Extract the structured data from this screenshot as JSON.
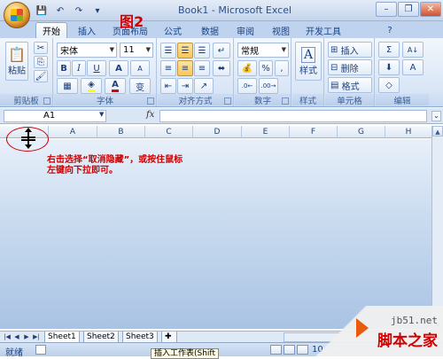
{
  "window": {
    "title": "Book1 - Microsoft Excel",
    "minimize": "–",
    "restore": "❐",
    "close": "✕"
  },
  "qat": {
    "save": "💾",
    "undo": "↶",
    "redo": "↷",
    "customize": "▾"
  },
  "annotation": {
    "figure_label": "图2",
    "instruction": "右击选择“取消隐藏”，或按住鼠标左键向下拉即可。"
  },
  "ribbon": {
    "tabs": [
      "开始",
      "插入",
      "页面布局",
      "公式",
      "数据",
      "审阅",
      "视图",
      "开发工具"
    ],
    "active_tab": "开始",
    "help": "?",
    "clipboard": {
      "label": "剪贴板",
      "paste": "粘贴"
    },
    "font": {
      "label": "字体",
      "name": "宋体",
      "size": "11",
      "grow": "A",
      "shrink": "A",
      "bold": "B",
      "italic": "I",
      "underline": "U",
      "phonetic": "变"
    },
    "alignment": {
      "label": "对齐方式"
    },
    "number": {
      "label": "数字",
      "format": "常规",
      "percent": "%",
      "comma": ","
    },
    "styles": {
      "label": "样式",
      "button": "样式"
    },
    "cells": {
      "label": "单元格",
      "insert": "插入",
      "delete": "删除",
      "format": "格式"
    },
    "editing": {
      "label": "编辑",
      "sum": "Σ",
      "sort": "A↓",
      "find": "A"
    }
  },
  "formula_bar": {
    "name_box": "A1",
    "fx": "fx",
    "value": ""
  },
  "sheet": {
    "columns": [
      "A",
      "B",
      "C",
      "D",
      "E",
      "F",
      "G",
      "H"
    ]
  },
  "sheet_tabs": [
    "Sheet1",
    "Sheet2",
    "Sheet3"
  ],
  "active_sheet": "Sheet1",
  "status": {
    "ready": "就绪",
    "tooltip": "插入工作表(Shift",
    "zoom": "10"
  },
  "watermark": {
    "url": "jb51.net",
    "name": "脚本之家"
  },
  "colors": {
    "accent": "#d00000",
    "ribbon_text": "#15428b"
  }
}
